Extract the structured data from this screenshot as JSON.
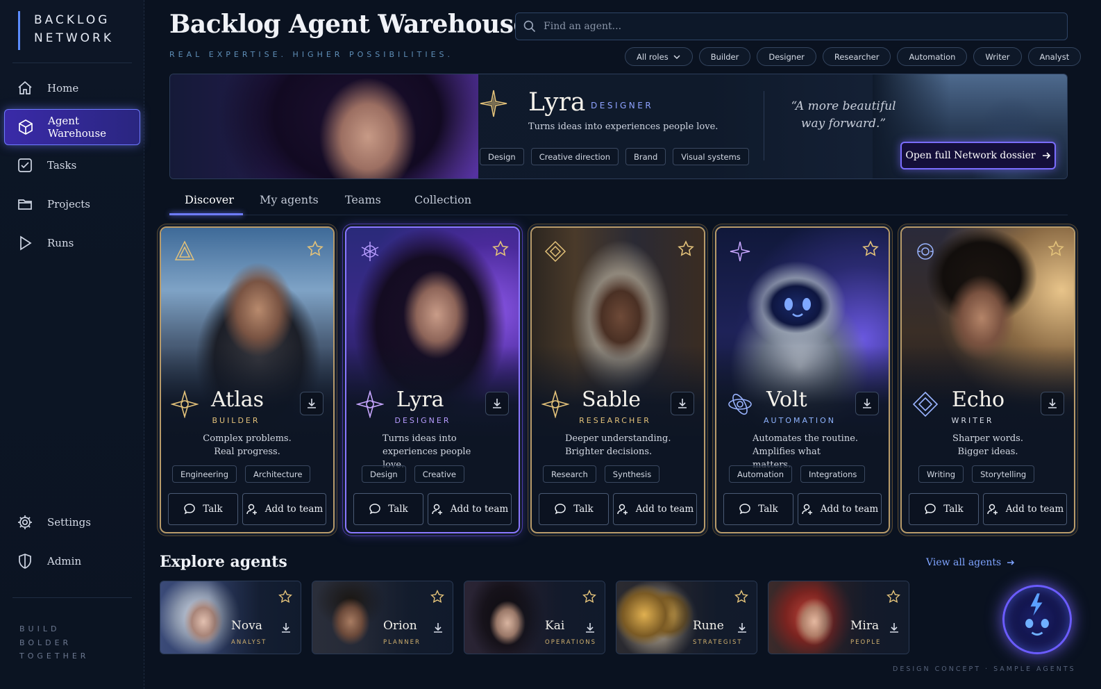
{
  "sidebar": {
    "brand": [
      "BACKLOG",
      "NETWORK"
    ],
    "nav": [
      {
        "label": "Home",
        "icon": "home-icon"
      },
      {
        "label": "Agent Warehouse",
        "icon": "cube-icon",
        "active": true
      },
      {
        "label": "Tasks",
        "icon": "checkbox-icon"
      },
      {
        "label": "Projects",
        "icon": "folder-icon"
      },
      {
        "label": "Runs",
        "icon": "play-icon"
      }
    ],
    "bottom_nav": [
      {
        "label": "Settings",
        "icon": "gear-icon"
      },
      {
        "label": "Admin",
        "icon": "shield-icon"
      }
    ],
    "tagline": [
      "BUILD",
      "BOLDER",
      "TOGETHER"
    ]
  },
  "header": {
    "title": "Backlog Agent Warehouse",
    "subtitle": "REAL EXPERTISE. HIGHER POSSIBILITIES.",
    "search_placeholder": "Find an agent...",
    "filters": [
      "All roles",
      "Builder",
      "Designer",
      "Researcher",
      "Automation",
      "Writer",
      "Analyst"
    ]
  },
  "hero": {
    "name": "Lyra",
    "role": "DESIGNER",
    "description": "Turns ideas into experiences people love.",
    "tags": [
      "Design",
      "Creative direction",
      "Brand",
      "Visual systems"
    ],
    "quote": "“A more beautiful way forward.”",
    "cta": "Open full Network dossier"
  },
  "tabs": [
    "Discover",
    "My agents",
    "Teams",
    "Collection"
  ],
  "cards": [
    {
      "name": "Atlas",
      "role": "BUILDER",
      "desc": [
        "Complex problems.",
        "Real progress."
      ],
      "tags": [
        "Engineering",
        "Architecture"
      ],
      "talk": "Talk",
      "add": "Add to team"
    },
    {
      "name": "Lyra",
      "role": "DESIGNER",
      "desc": [
        "Turns ideas into",
        "experiences people love."
      ],
      "tags": [
        "Design",
        "Creative"
      ],
      "talk": "Talk",
      "add": "Add to team"
    },
    {
      "name": "Sable",
      "role": "RESEARCHER",
      "desc": [
        "Deeper understanding.",
        "Brighter decisions."
      ],
      "tags": [
        "Research",
        "Synthesis"
      ],
      "talk": "Talk",
      "add": "Add to team"
    },
    {
      "name": "Volt",
      "role": "AUTOMATION",
      "desc": [
        "Automates the routine.",
        "Amplifies what matters."
      ],
      "tags": [
        "Automation",
        "Integrations"
      ],
      "talk": "Talk",
      "add": "Add to team"
    },
    {
      "name": "Echo",
      "role": "WRITER",
      "desc": [
        "Sharper words.",
        "Bigger ideas."
      ],
      "tags": [
        "Writing",
        "Storytelling"
      ],
      "talk": "Talk",
      "add": "Add to team"
    }
  ],
  "explore": {
    "title": "Explore agents",
    "view_all": "View all agents",
    "agents": [
      {
        "name": "Nova",
        "role": "ANALYST"
      },
      {
        "name": "Orion",
        "role": "PLANNER"
      },
      {
        "name": "Kai",
        "role": "OPERATIONS"
      },
      {
        "name": "Rune",
        "role": "STRATEGIST"
      },
      {
        "name": "Mira",
        "role": "PEOPLE"
      }
    ]
  },
  "footnote": "DESIGN CONCEPT · SAMPLE AGENTS",
  "colors": {
    "accent": "#6e7cff",
    "gold": "#b89b6a",
    "background": "#0a1220"
  }
}
